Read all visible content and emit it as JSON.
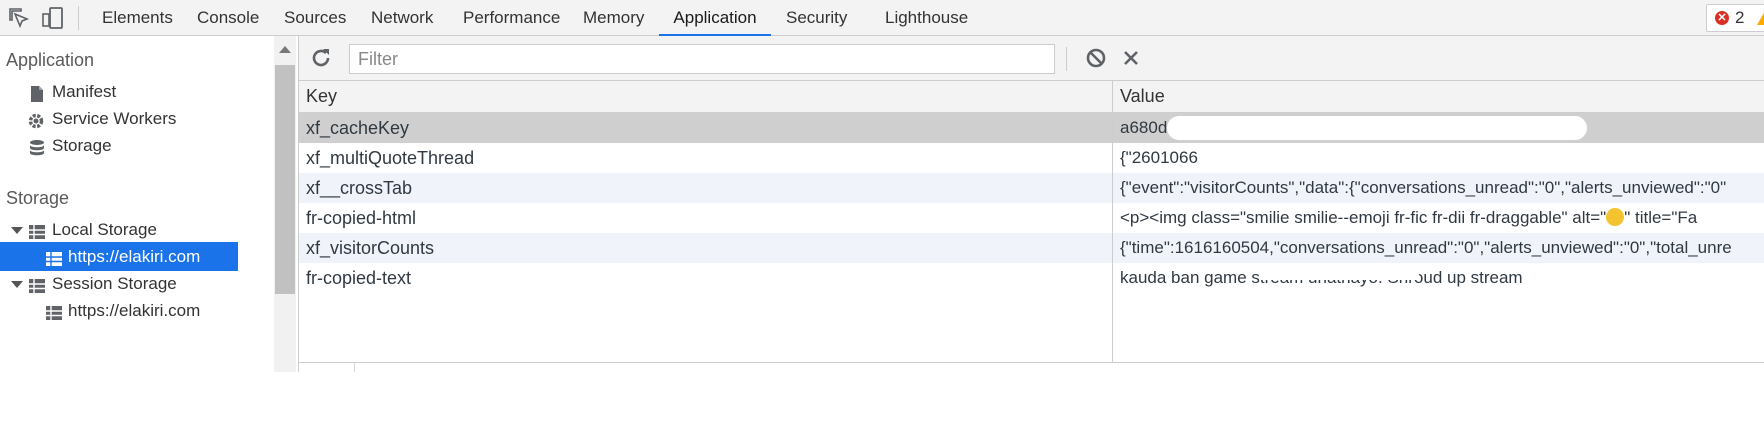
{
  "toolbar_top": {
    "inspect_icon": "inspect-element-icon",
    "device_icon": "device-toolbar-icon",
    "tabs": [
      {
        "label": "Elements"
      },
      {
        "label": "Console"
      },
      {
        "label": "Sources"
      },
      {
        "label": "Network"
      },
      {
        "label": "Performance"
      },
      {
        "label": "Memory"
      },
      {
        "label": "Application"
      },
      {
        "label": "Security"
      },
      {
        "label": "Lighthouse"
      }
    ],
    "active_tab": "Application",
    "error_count": "2",
    "accent_color": "#1a73e8"
  },
  "sidebar": {
    "application_heading": "Application",
    "application_items": [
      {
        "label": "Manifest",
        "icon": "file-icon"
      },
      {
        "label": "Service Workers",
        "icon": "gear-icon"
      },
      {
        "label": "Storage",
        "icon": "database-icon"
      }
    ],
    "storage_heading": "Storage",
    "local_storage": {
      "label": "Local Storage",
      "child": "https://elakiri.com"
    },
    "session_storage": {
      "label": "Session Storage",
      "child": "https://elakiri.com"
    }
  },
  "storage_toolbar": {
    "refresh_icon": "refresh-icon",
    "filter_placeholder": "Filter",
    "filter_value": "",
    "clear_all_icon": "block-icon",
    "delete_icon": "close-icon"
  },
  "grid": {
    "headers": {
      "key": "Key",
      "value": "Value"
    },
    "rows": [
      {
        "key": "xf_cacheKey",
        "value": "a680dc"
      },
      {
        "key": "xf_multiQuoteThread",
        "value": "{\"2601066"
      },
      {
        "key": "xf__crossTab",
        "value": "{\"event\":\"visitorCounts\",\"data\":{\"conversations_unread\":\"0\",\"alerts_unviewed\":\"0\""
      },
      {
        "key": "fr-copied-html",
        "value_before": "<p><img class=\"smilie smilie--emoji fr-fic fr-dii fr-draggable\" alt=\"",
        "value_after": "\" title=\"Fa"
      },
      {
        "key": "xf_visitorCounts",
        "value": "{\"time\":1616160504,\"conversations_unread\":\"0\",\"alerts_unviewed\":\"0\",\"total_unre"
      },
      {
        "key": "fr-copied-text",
        "value": "kauda ban game stream unathayo. Shroud up stream"
      }
    ],
    "selected_row": 0
  }
}
